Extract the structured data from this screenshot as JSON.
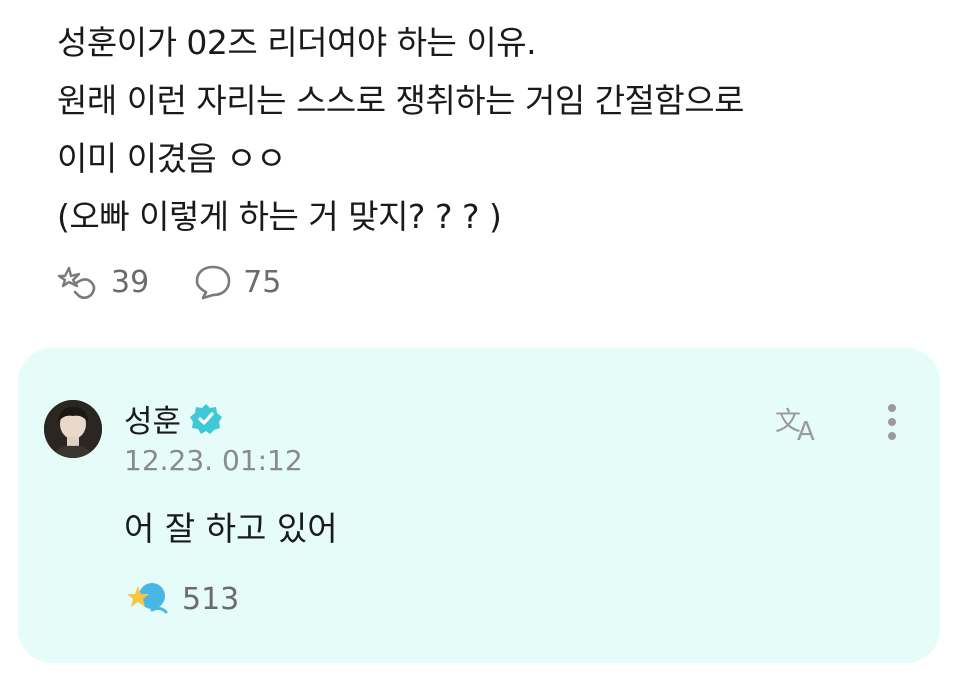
{
  "post": {
    "lines": [
      "성훈이가 02즈 리더여야 하는 이유.",
      "원래 이런 자리는 스스로 쟁취하는 거임 간절함으로",
      "이미 이겼음 ㅇㅇ",
      "(오빠 이렇게 하는 거 맞지? ? ? )"
    ],
    "like_count": "39",
    "comment_count": "75"
  },
  "reply": {
    "author": "성훈",
    "timestamp": "12.23. 01:12",
    "text": "어 잘 하고 있어",
    "like_count": "513",
    "accent_color": "#e6fcf8",
    "verified_color": "#3fc9d6"
  },
  "icons": {
    "like": "hand-sparkle-icon",
    "comment": "speech-bubble-icon",
    "translate": "translate-icon",
    "more": "more-vertical-icon",
    "verified": "verified-badge-icon",
    "reaction": "star-sparkle-icon"
  }
}
